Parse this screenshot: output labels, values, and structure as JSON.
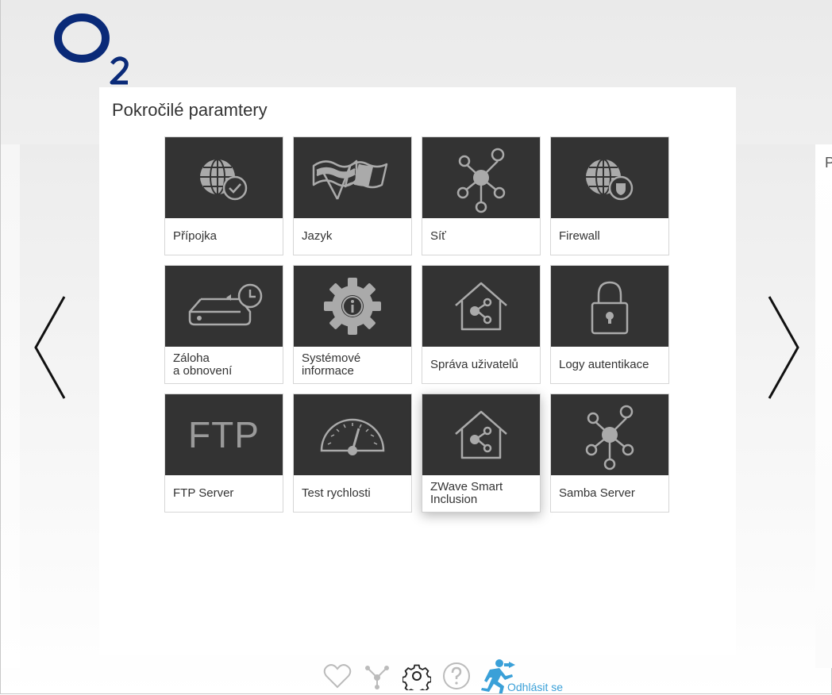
{
  "brand": {
    "logo_letter": "O",
    "logo_sub": "2",
    "color": "#0a2a78"
  },
  "panel": {
    "title": "Pokročilé paramtery"
  },
  "side_peek": "P",
  "tiles": [
    {
      "label": "Přípojka",
      "icon": "globe-check-icon"
    },
    {
      "label": "Jazyk",
      "icon": "flags-icon"
    },
    {
      "label": "Síť",
      "icon": "network-nodes-icon"
    },
    {
      "label": "Firewall",
      "icon": "globe-shield-icon"
    },
    {
      "label": "Záloha\na obnovení",
      "icon": "backup-clock-icon"
    },
    {
      "label": "Systémové\ninformace",
      "icon": "gear-info-icon"
    },
    {
      "label": "Správa uživatelů",
      "icon": "house-nodes-icon"
    },
    {
      "label": "Logy autentikace",
      "icon": "padlock-icon"
    },
    {
      "label": "FTP Server",
      "icon": "ftp-text-icon",
      "icon_text": "FTP"
    },
    {
      "label": "Test rychlosti",
      "icon": "speedometer-icon"
    },
    {
      "label": "ZWave Smart\nInclusion",
      "icon": "house-nodes-icon",
      "active": true
    },
    {
      "label": "Samba Server",
      "icon": "network-nodes-icon"
    }
  ],
  "footer": {
    "items": [
      "heart-icon",
      "network-icon",
      "gear-icon",
      "help-icon"
    ],
    "logout_label": "Odhlásit se",
    "accent": "#3aa0d8"
  },
  "colors": {
    "tile_bg": "#333333",
    "icon": "#aaaaaa",
    "text": "#333333"
  }
}
